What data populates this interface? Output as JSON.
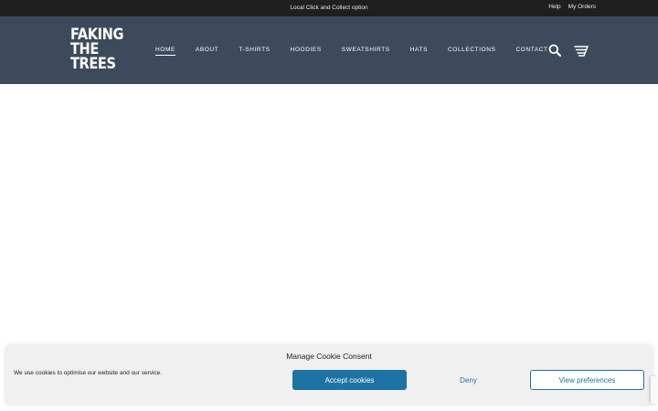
{
  "topbar": {
    "promo": "Local Click and Collect option",
    "links": [
      "Help",
      "My Orders"
    ]
  },
  "logo": {
    "lines": [
      "FAKING",
      "THE",
      "TREES"
    ]
  },
  "nav": {
    "items": [
      "HOME",
      "ABOUT",
      "T-SHIRTS",
      "HOODIES",
      "SWEATSHIRTS",
      "HATS",
      "COLLECTIONS",
      "CONTACT"
    ],
    "active": "HOME"
  },
  "icons": {
    "search": "search-icon",
    "cart": "cart-icon"
  },
  "colors": {
    "header_bg": "#3d4a5c",
    "topbar_bg": "#1f1f1f",
    "accent": "#1e73a5"
  },
  "cookie": {
    "title": "Manage Cookie Consent",
    "message": "We use cookies to optimise our website and our service.",
    "accept_label": "Accept cookies",
    "deny_label": "Deny",
    "prefs_label": "View preferences"
  }
}
